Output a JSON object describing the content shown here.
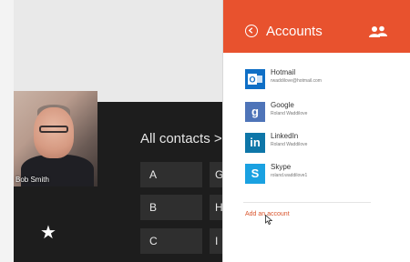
{
  "contacts_view": {
    "heading": "All contacts",
    "heading_chevron": ">",
    "letters": [
      "A",
      "B",
      "C"
    ],
    "partial_letters": [
      "G",
      "H",
      "I"
    ],
    "favorite_contact": {
      "name": "Bob Smith"
    },
    "star_icon": "star-icon"
  },
  "accounts_flyout": {
    "title": "Accounts",
    "back_icon": "back-arrow-circle-icon",
    "people_icon": "people-icon",
    "accent_color": "#e8522e",
    "accounts": [
      {
        "name": "Hotmail",
        "detail": "rwaddilove@hotmail.com",
        "icon": "outlook-icon",
        "color": "#0f6fc6"
      },
      {
        "name": "Google",
        "detail": "Roland Waddilove",
        "icon": "google-icon",
        "color": "#4e74b8"
      },
      {
        "name": "LinkedIn",
        "detail": "Roland Waddilove",
        "icon": "linkedin-icon",
        "color": "#0e76a8"
      },
      {
        "name": "Skype",
        "detail": "roland.waddilove1",
        "icon": "skype-icon",
        "color": "#1aa1e1"
      }
    ],
    "add_account_label": "Add an account"
  }
}
